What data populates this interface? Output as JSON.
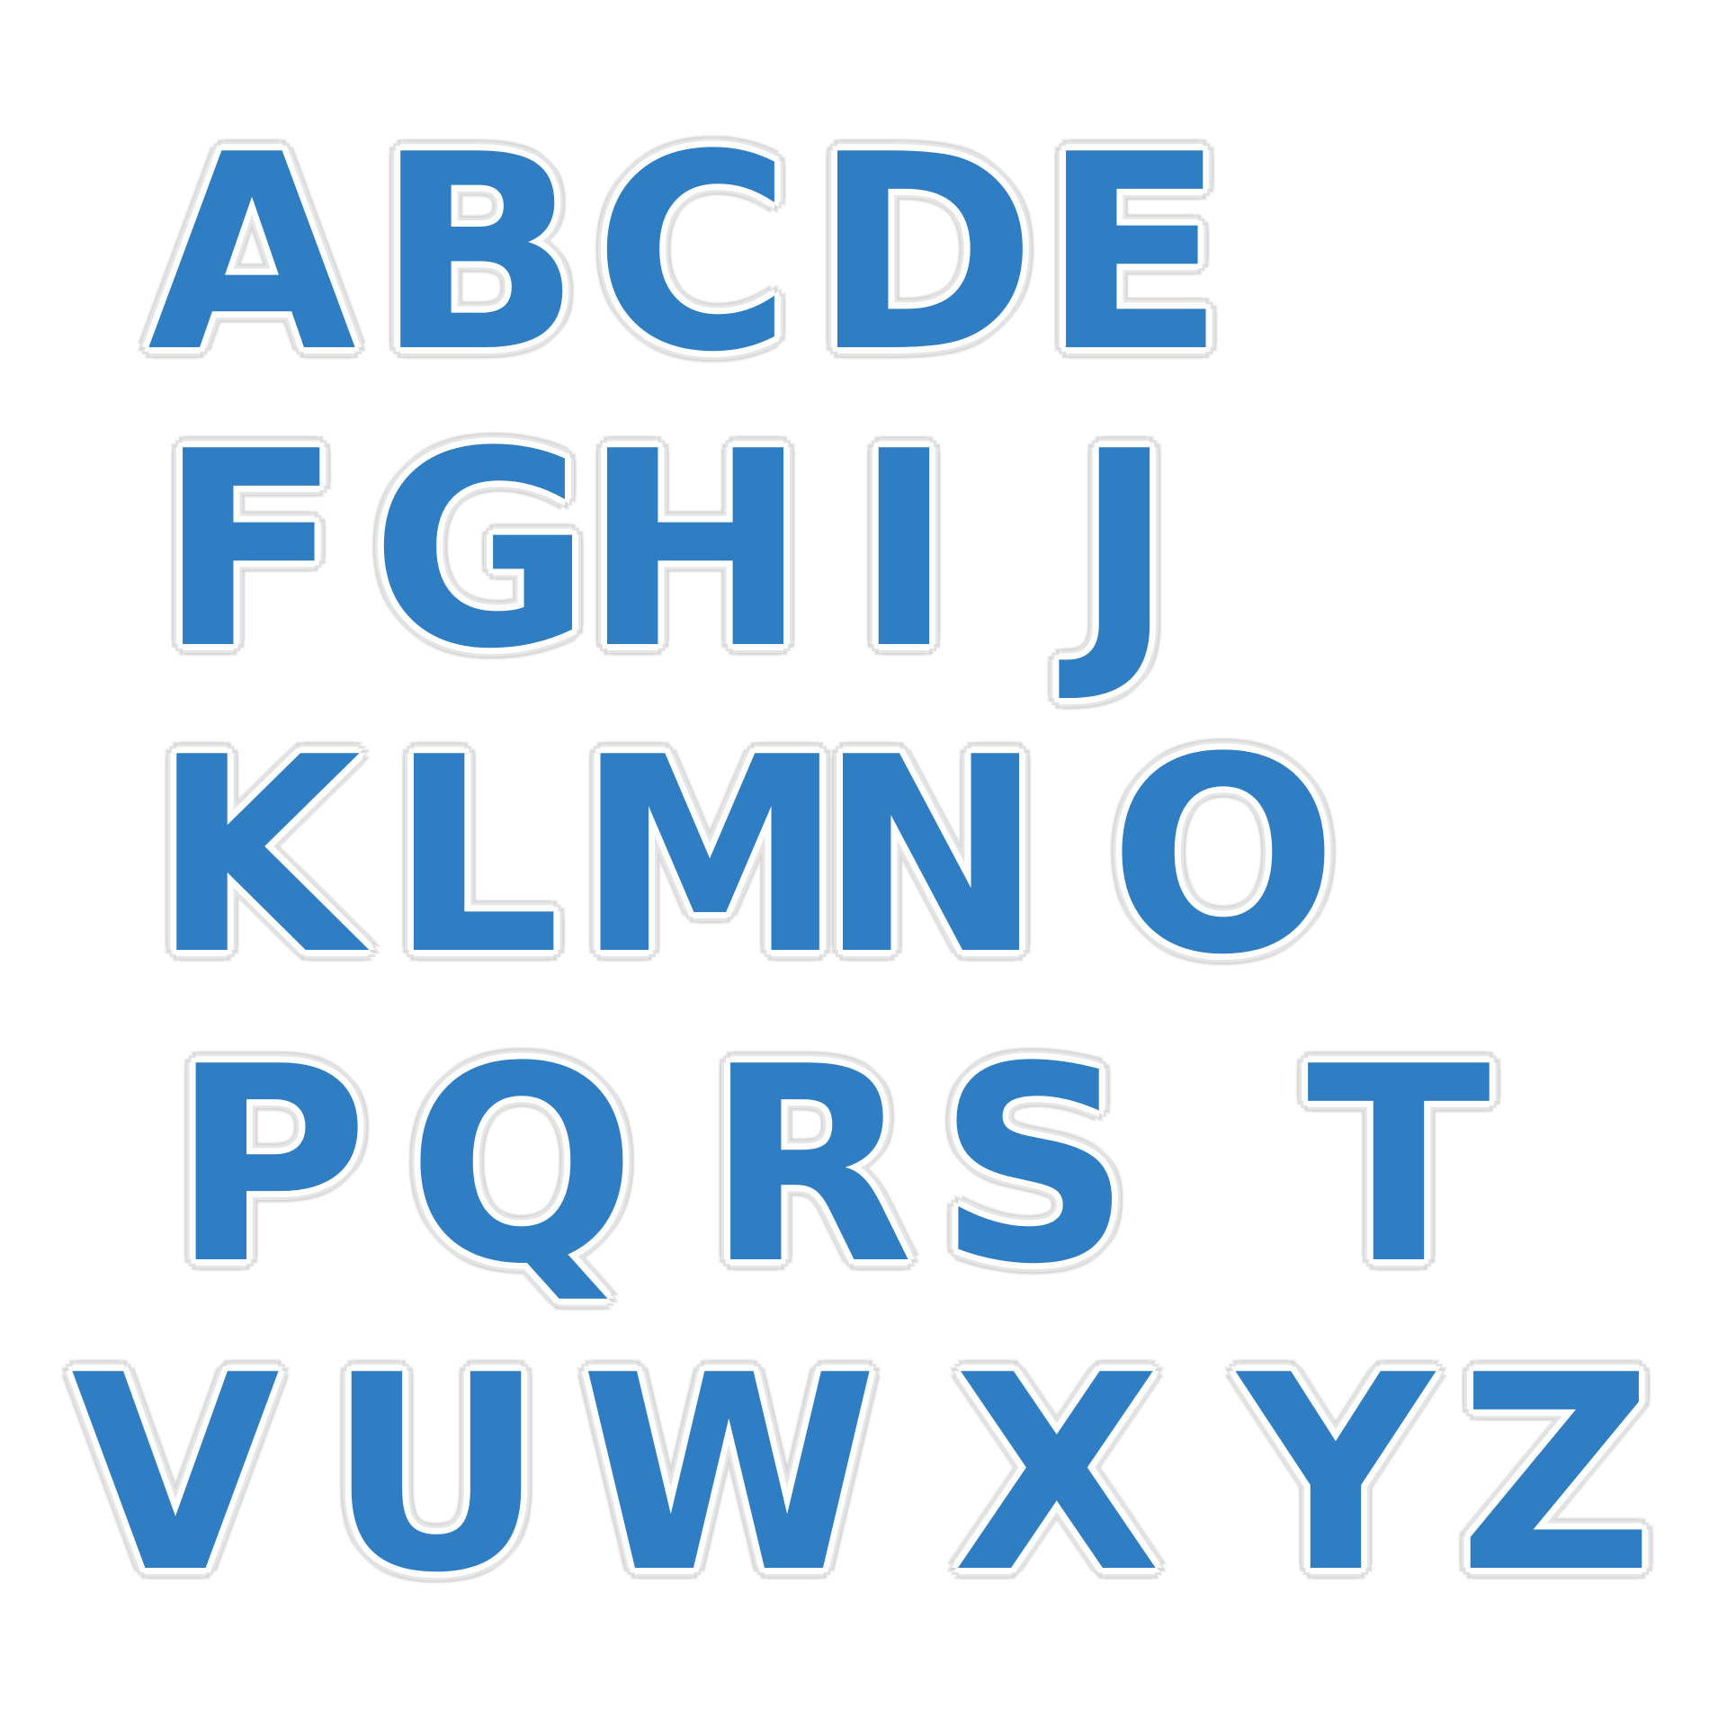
{
  "colors": {
    "thread_blue": "#2f7dc3",
    "thread_blue_dark": "#1f5f9c",
    "border_white": "#ffffff",
    "background": "#ffffff"
  },
  "rows": [
    [
      "A",
      "B",
      "C",
      "D",
      "E"
    ],
    [
      "F",
      "G",
      "H",
      "I",
      "J"
    ],
    [
      "K",
      "L",
      "M",
      "N",
      "O"
    ],
    [
      "P",
      "Q",
      "R",
      "S",
      "T"
    ],
    [
      "V",
      "U",
      "W",
      "X",
      "Y",
      "Z"
    ]
  ]
}
